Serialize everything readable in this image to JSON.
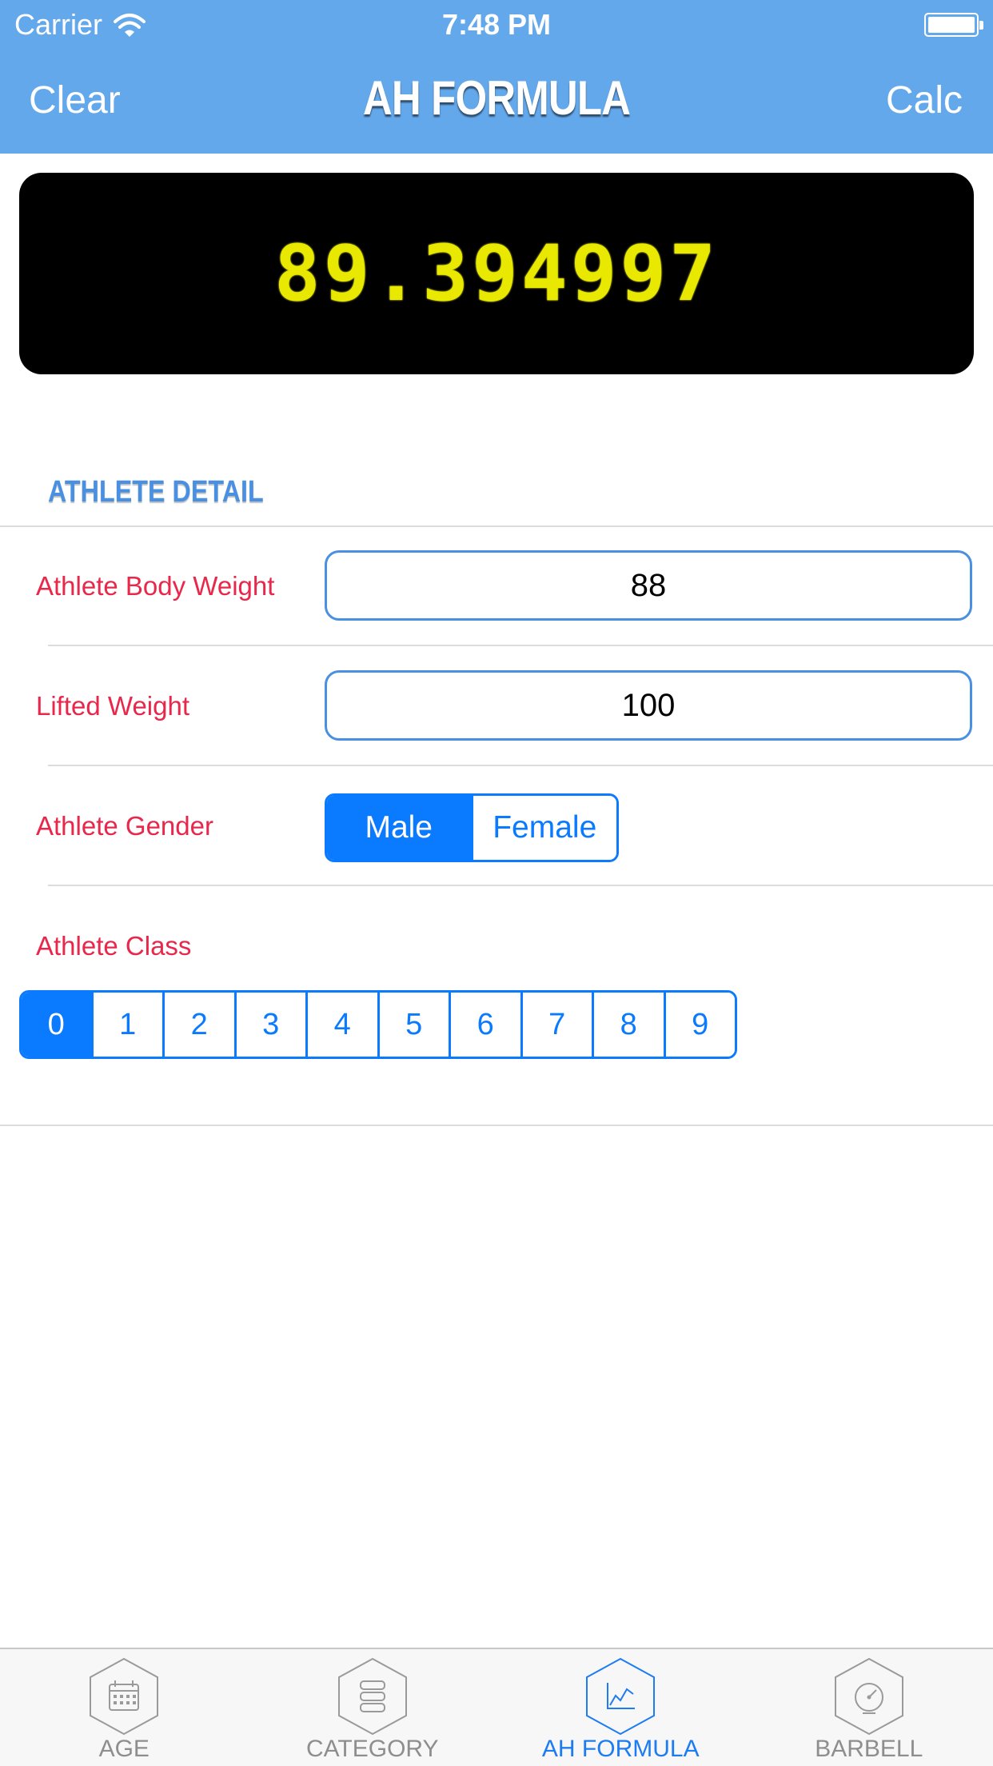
{
  "status_bar": {
    "carrier": "Carrier",
    "time": "7:48 PM"
  },
  "nav": {
    "left_button": "Clear",
    "title": "AH FORMULA",
    "right_button": "Calc"
  },
  "display": {
    "value": "89.394997",
    "text_color": "#e8e800"
  },
  "section": {
    "title": "ATHLETE DETAIL"
  },
  "form": {
    "body_weight": {
      "label": "Athlete Body Weight",
      "value": "88"
    },
    "lifted_weight": {
      "label": "Lifted Weight",
      "value": "100"
    },
    "gender": {
      "label": "Athlete Gender",
      "options": [
        "Male",
        "Female"
      ],
      "selected": "Male"
    },
    "class": {
      "label": "Athlete Class",
      "options": [
        "0",
        "1",
        "2",
        "3",
        "4",
        "5",
        "6",
        "7",
        "8",
        "9"
      ],
      "selected": "0"
    }
  },
  "tabs": [
    {
      "label": "AGE",
      "icon": "calendar-icon",
      "active": false
    },
    {
      "label": "CATEGORY",
      "icon": "stack-icon",
      "active": false
    },
    {
      "label": "AH FORMULA",
      "icon": "chart-icon",
      "active": true
    },
    {
      "label": "BARBELL",
      "icon": "gauge-icon",
      "active": false
    }
  ],
  "colors": {
    "header": "#64a8ec",
    "accent": "#0a7aff",
    "label": "#e8274b",
    "section_title": "#4a90e2"
  }
}
